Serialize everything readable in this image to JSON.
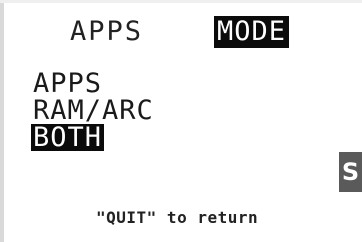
{
  "header": {
    "tabs": [
      {
        "label": "APPS",
        "selected": false
      },
      {
        "label": "MODE",
        "selected": true
      }
    ]
  },
  "menu": {
    "items": [
      {
        "label": "APPS",
        "selected": false
      },
      {
        "label": "RAM/ARC",
        "selected": false
      },
      {
        "label": "BOTH",
        "selected": true
      }
    ]
  },
  "side_badge": "S",
  "footer": "\"QUIT\" to return",
  "colors": {
    "highlight": "#0b0b0b",
    "text": "#1a1a1a",
    "background": "#ffffff",
    "badge": "#5a5a5a"
  }
}
